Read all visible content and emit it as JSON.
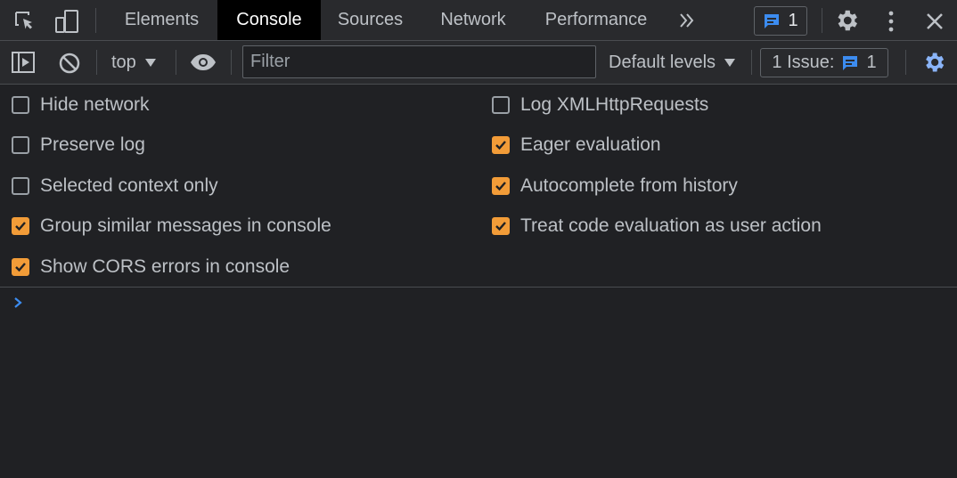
{
  "tabs": [
    "Elements",
    "Console",
    "Sources",
    "Network",
    "Performance"
  ],
  "active_tab": "Console",
  "header": {
    "messages_count": "1"
  },
  "toolbar": {
    "context": "top",
    "filter_placeholder": "Filter",
    "levels": "Default levels",
    "issues_label": "1 Issue:",
    "issues_count": "1"
  },
  "settings": {
    "left": [
      {
        "label": "Hide network",
        "checked": false
      },
      {
        "label": "Preserve log",
        "checked": false
      },
      {
        "label": "Selected context only",
        "checked": false
      },
      {
        "label": "Group similar messages in console",
        "checked": true
      },
      {
        "label": "Show CORS errors in console",
        "checked": true
      }
    ],
    "right": [
      {
        "label": "Log XMLHttpRequests",
        "checked": false
      },
      {
        "label": "Eager evaluation",
        "checked": true
      },
      {
        "label": "Autocomplete from history",
        "checked": true
      },
      {
        "label": "Treat code evaluation as user action",
        "checked": true
      }
    ]
  },
  "colors": {
    "accent": "#f29c38",
    "link_blue": "#8ab4f8",
    "issue_blue": "#3c8cf0"
  }
}
